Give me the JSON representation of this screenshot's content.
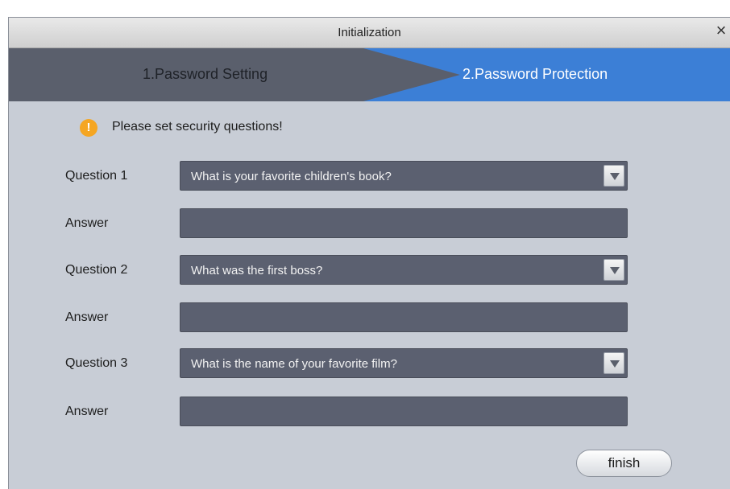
{
  "window": {
    "title": "Initialization",
    "close_symbol": "×"
  },
  "steps": [
    {
      "label": "1.Password Setting",
      "state": "done"
    },
    {
      "label": "2.Password Protection",
      "state": "active"
    }
  ],
  "colors": {
    "step_inactive": "#5a5f6c",
    "step_active": "#3c7fd6",
    "background": "#c8cdd6",
    "field": "#5b6070",
    "warning": "#f5a623"
  },
  "notice": {
    "icon": "warning-icon",
    "icon_glyph": "!",
    "text": "Please set security questions!"
  },
  "questions": [
    {
      "label": "Question 1",
      "selected": "What is your favorite children's book?",
      "answer_label": "Answer",
      "answer_value": ""
    },
    {
      "label": "Question 2",
      "selected": "What was the first boss?",
      "answer_label": "Answer",
      "answer_value": ""
    },
    {
      "label": "Question 3",
      "selected": "What is the name of your favorite film?",
      "answer_label": "Answer",
      "answer_value": ""
    }
  ],
  "buttons": {
    "finish": "finish"
  }
}
